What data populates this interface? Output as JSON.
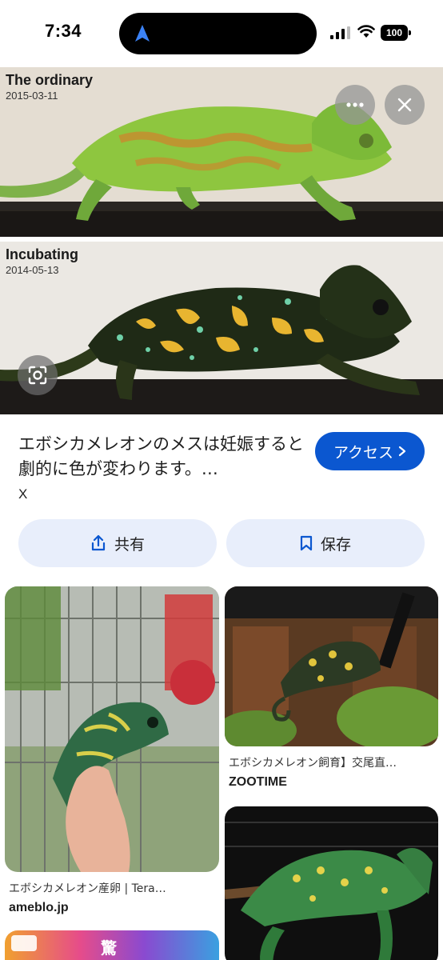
{
  "status_bar": {
    "time": "7:34",
    "battery": "100"
  },
  "hero": {
    "panels": [
      {
        "title": "The ordinary",
        "date": "2015-03-11"
      },
      {
        "title": "Incubating",
        "date": "2014-05-13"
      }
    ],
    "more_icon": "more-horizontal-icon",
    "close_icon": "close-icon",
    "lens_icon": "lens-icon"
  },
  "result": {
    "title": "エボシカメレオンのメスは妊娠すると劇的に色が変わります。…",
    "source": "X",
    "visit_label": "アクセス",
    "visit_icon": "chevron-right-icon",
    "share_label": "共有",
    "share_icon": "share-icon",
    "save_label": "保存",
    "save_icon": "bookmark-icon"
  },
  "related": [
    {
      "caption": "エボシカメレオン産卵 | Tera…",
      "site": "ameblo.jp"
    },
    {
      "caption": "エボシカメレオン飼育】交尾直…",
      "site": "ZOOTIME"
    },
    {
      "caption": "",
      "site": ""
    },
    {
      "caption": "",
      "site": ""
    }
  ],
  "bottom_card_text": "驚",
  "colors": {
    "accent": "#0b57d0",
    "action_bg": "#e8eefb"
  }
}
